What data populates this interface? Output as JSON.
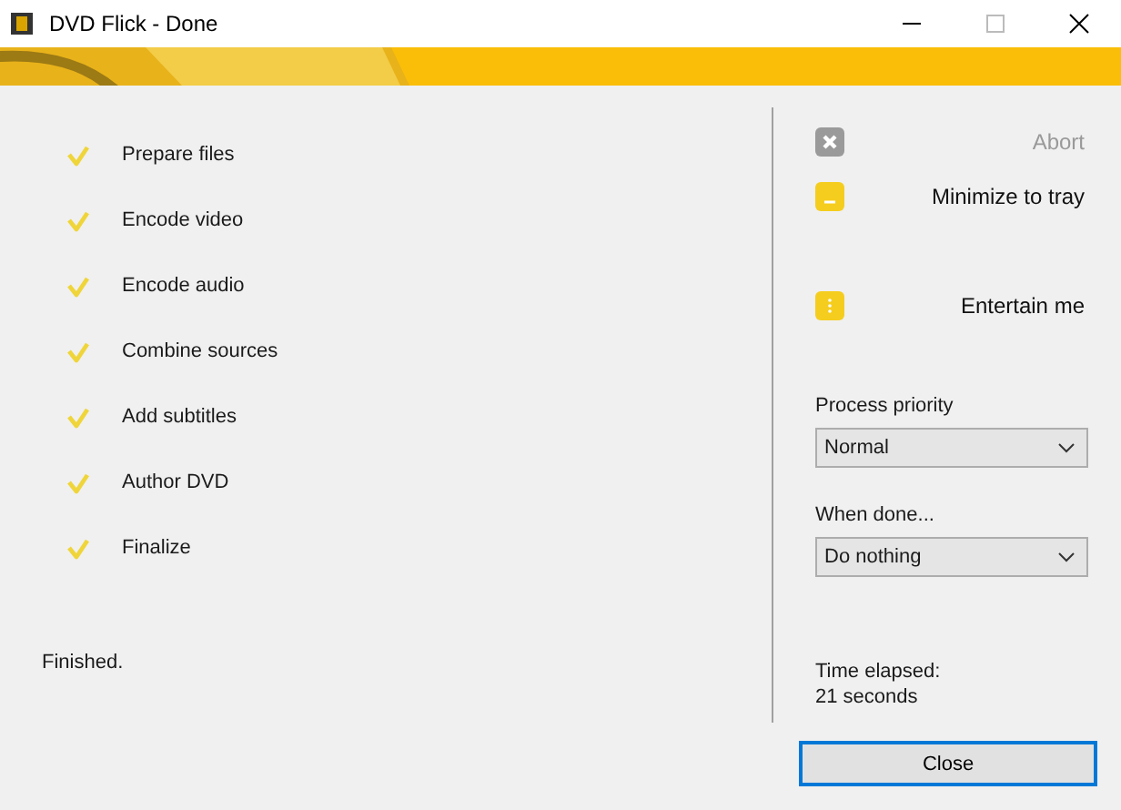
{
  "window": {
    "title": "DVD Flick - Done"
  },
  "steps": [
    {
      "label": "Prepare files",
      "done": true
    },
    {
      "label": "Encode video",
      "done": true
    },
    {
      "label": "Encode audio",
      "done": true
    },
    {
      "label": "Combine sources",
      "done": true
    },
    {
      "label": "Add subtitles",
      "done": true
    },
    {
      "label": "Author DVD",
      "done": true
    },
    {
      "label": "Finalize",
      "done": true
    }
  ],
  "status": "Finished.",
  "actions": [
    {
      "kind": "abort",
      "label": "Abort",
      "disabled": true
    },
    {
      "kind": "minimize",
      "label": "Minimize to tray",
      "disabled": false
    },
    {
      "kind": "entertain",
      "label": "Entertain me",
      "disabled": false
    }
  ],
  "process_priority": {
    "label": "Process priority",
    "value": "Normal"
  },
  "when_done": {
    "label": "When done...",
    "value": "Do nothing"
  },
  "time_elapsed": {
    "label": "Time elapsed:",
    "value": "21 seconds"
  },
  "buttons": [
    "Close"
  ]
}
